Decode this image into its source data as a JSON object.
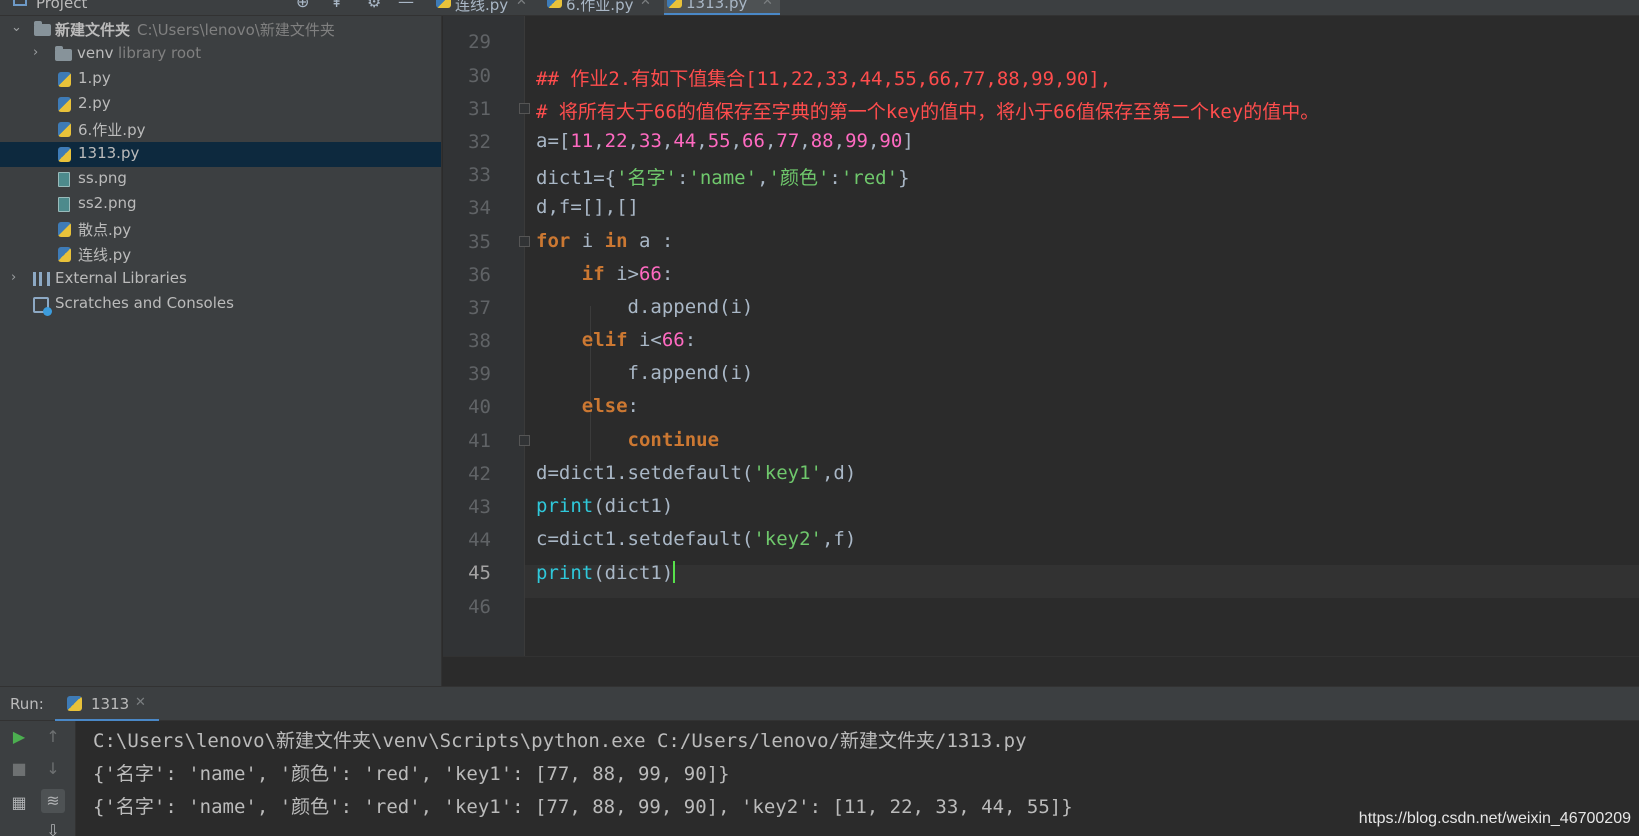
{
  "project_header": {
    "title": "Project"
  },
  "tabs": [
    {
      "label": "连线.py"
    },
    {
      "label": "6.作业.py"
    },
    {
      "label": "1313.py"
    }
  ],
  "tree": {
    "root": {
      "label": "新建文件夹",
      "path": "C:\\Users\\lenovo\\新建文件夹"
    },
    "venv": {
      "label": "venv",
      "hint": "library root"
    },
    "files": [
      "1.py",
      "2.py",
      "6.作业.py",
      "1313.py",
      "ss.png",
      "ss2.png",
      "散点.py",
      "连线.py"
    ],
    "selected": "1313.py",
    "external": "External Libraries",
    "scratches": "Scratches and Consoles"
  },
  "editor": {
    "current_line": 45,
    "lines": [
      {
        "n": 29,
        "code": ""
      },
      {
        "n": 30,
        "code": "## 作业2.有如下值集合[11,22,33,44,55,66,77,88,99,90],",
        "type": "comment"
      },
      {
        "n": 31,
        "code": "# 将所有大于66的值保存至字典的第一个key的值中，将小于66值保存至第二个key的值中。",
        "type": "comment"
      },
      {
        "n": 32,
        "code": "a=[11,22,33,44,55,66,77,88,99,90]"
      },
      {
        "n": 33,
        "code": "dict1={'名字':'name','颜色':'red'}"
      },
      {
        "n": 34,
        "code": "d,f=[],[]"
      },
      {
        "n": 35,
        "code": "for i in a :"
      },
      {
        "n": 36,
        "code": "    if i>66:"
      },
      {
        "n": 37,
        "code": "        d.append(i)"
      },
      {
        "n": 38,
        "code": "    elif i<66:"
      },
      {
        "n": 39,
        "code": "        f.append(i)"
      },
      {
        "n": 40,
        "code": "    else:"
      },
      {
        "n": 41,
        "code": "        continue"
      },
      {
        "n": 42,
        "code": "d=dict1.setdefault('key1',d)"
      },
      {
        "n": 43,
        "code": "print(dict1)"
      },
      {
        "n": 44,
        "code": "c=dict1.setdefault('key2',f)"
      },
      {
        "n": 45,
        "code": "print(dict1)"
      },
      {
        "n": 46,
        "code": ""
      }
    ]
  },
  "run": {
    "label": "Run:",
    "tab": "1313",
    "output": [
      "C:\\Users\\lenovo\\新建文件夹\\venv\\Scripts\\python.exe C:/Users/lenovo/新建文件夹/1313.py",
      "{'名字': 'name', '颜色': 'red', 'key1': [77, 88, 99, 90]}",
      "{'名字': 'name', '颜色': 'red', 'key1': [77, 88, 99, 90], 'key2': [11, 22, 33, 44, 55]}"
    ]
  },
  "watermark": "https://blog.csdn.net/weixin_46700209",
  "colors": {
    "keyword": "#cc7832",
    "number": "#ff6ac1",
    "string": "#6fc86c",
    "builtin": "#2fc8da",
    "comment": "#ff4d4d",
    "selection": "#0d293e",
    "accent": "#4a88c7"
  }
}
